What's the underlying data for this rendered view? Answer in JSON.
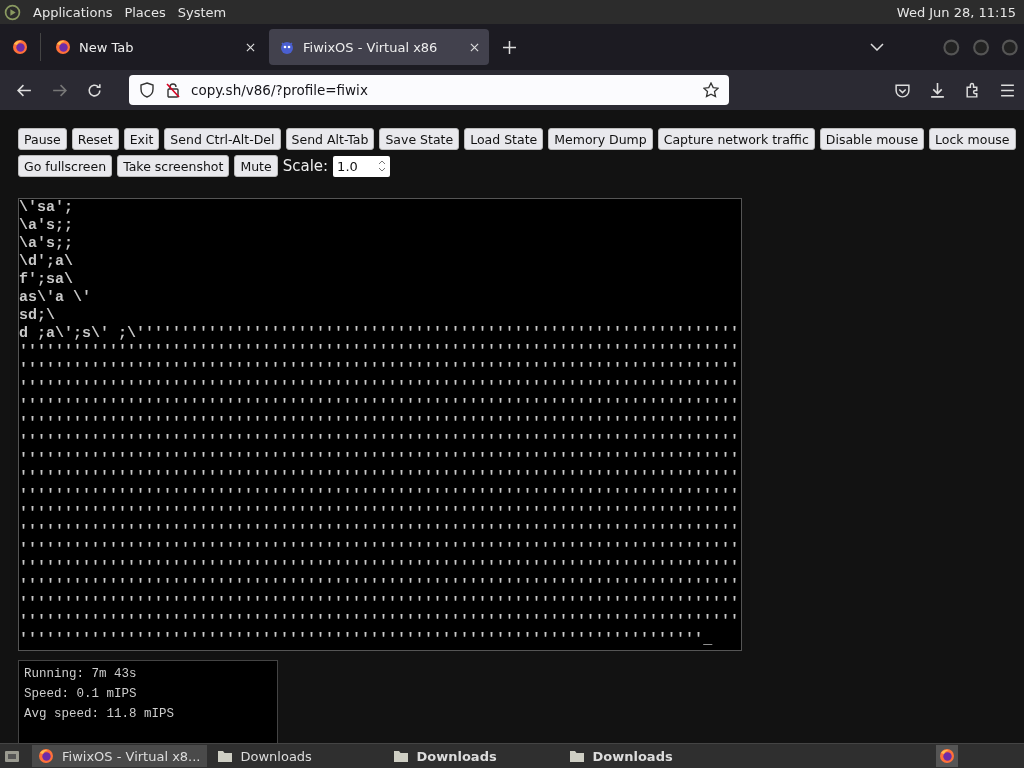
{
  "top_panel": {
    "menus": [
      "Applications",
      "Places",
      "System"
    ],
    "clock": "Wed Jun 28, 11:15"
  },
  "browser": {
    "tabs": [
      {
        "title": "New Tab",
        "selected": false
      },
      {
        "title": "FiwixOS - Virtual x86",
        "selected": true
      }
    ],
    "url": "copy.sh/v86/?profile=fiwix"
  },
  "controls": {
    "button_rows": [
      [
        "Pause",
        "Reset",
        "Exit",
        "Send Ctrl-Alt-Del",
        "Send Alt-Tab",
        "Save State",
        "Load State",
        "Memory Dump",
        "Capture network traffic",
        "Disable mouse",
        "Lock mouse"
      ],
      [
        "Go fullscreen",
        "Take screenshot",
        "Mute"
      ]
    ],
    "scale_label": "Scale:",
    "scale_value": "1.0"
  },
  "terminal": {
    "lines": [
      "\\'sa';",
      "\\a's;;",
      "\\a's;;",
      "\\d';a\\",
      "f';sa\\",
      "as\\'a \\'",
      "sd;\\",
      "d ;a\\';s\\' ;\\'''''''''''''''''''''''''''''''''''''''''''''''''''''''''''''''''''",
      "''''''''''''''''''''''''''''''''''''''''''''''''''''''''''''''''''''''''''''''''",
      "''''''''''''''''''''''''''''''''''''''''''''''''''''''''''''''''''''''''''''''''",
      "''''''''''''''''''''''''''''''''''''''''''''''''''''''''''''''''''''''''''''''''",
      "''''''''''''''''''''''''''''''''''''''''''''''''''''''''''''''''''''''''''''''''",
      "''''''''''''''''''''''''''''''''''''''''''''''''''''''''''''''''''''''''''''''''",
      "''''''''''''''''''''''''''''''''''''''''''''''''''''''''''''''''''''''''''''''''",
      "''''''''''''''''''''''''''''''''''''''''''''''''''''''''''''''''''''''''''''''''",
      "''''''''''''''''''''''''''''''''''''''''''''''''''''''''''''''''''''''''''''''''",
      "''''''''''''''''''''''''''''''''''''''''''''''''''''''''''''''''''''''''''''''''",
      "''''''''''''''''''''''''''''''''''''''''''''''''''''''''''''''''''''''''''''''''",
      "''''''''''''''''''''''''''''''''''''''''''''''''''''''''''''''''''''''''''''''''",
      "''''''''''''''''''''''''''''''''''''''''''''''''''''''''''''''''''''''''''''''''",
      "''''''''''''''''''''''''''''''''''''''''''''''''''''''''''''''''''''''''''''''''",
      "''''''''''''''''''''''''''''''''''''''''''''''''''''''''''''''''''''''''''''''''",
      "''''''''''''''''''''''''''''''''''''''''''''''''''''''''''''''''''''''''''''''''",
      "''''''''''''''''''''''''''''''''''''''''''''''''''''''''''''''''''''''''''''''''",
      "''''''''''''''''''''''''''''''''''''''''''''''''''''''''''''''''''''''''''''"
    ],
    "cursor": "_"
  },
  "stats": [
    "Running: 7m 43s",
    "Speed: 0.1 mIPS",
    "Avg speed: 11.8 mIPS"
  ],
  "taskbar": {
    "items": [
      {
        "label": "FiwixOS - Virtual x8...",
        "kind": "browser",
        "selected": true,
        "bold": false
      },
      {
        "label": "Downloads",
        "kind": "folder",
        "selected": false,
        "bold": false
      },
      {
        "label": "Downloads",
        "kind": "folder",
        "selected": false,
        "bold": true
      },
      {
        "label": "Downloads",
        "kind": "folder",
        "selected": false,
        "bold": true
      }
    ]
  }
}
